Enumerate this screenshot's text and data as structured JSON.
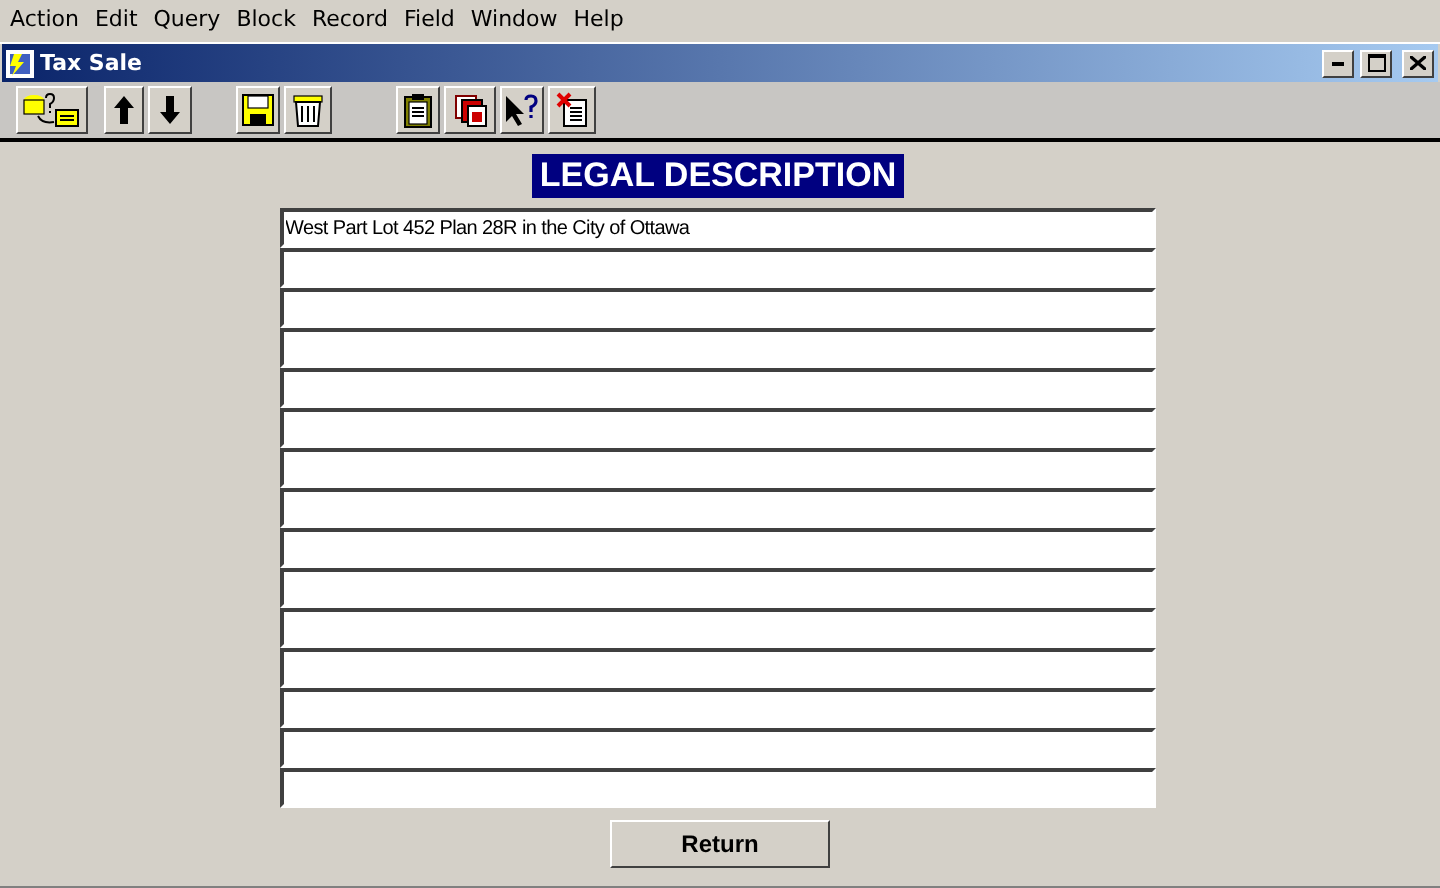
{
  "menu": [
    "Action",
    "Edit",
    "Query",
    "Block",
    "Record",
    "Field",
    "Window",
    "Help"
  ],
  "window": {
    "title": "Tax Sale"
  },
  "toolbar": [
    {
      "kind": "query"
    },
    {
      "kind": "gap"
    },
    {
      "kind": "up"
    },
    {
      "kind": "down"
    },
    {
      "kind": "gap"
    },
    {
      "kind": "save"
    },
    {
      "kind": "delete"
    },
    {
      "kind": "gap"
    },
    {
      "kind": "clipboard"
    },
    {
      "kind": "copy"
    },
    {
      "kind": "help"
    },
    {
      "kind": "exit"
    }
  ],
  "heading": "LEGAL DESCRIPTION",
  "lines": [
    {
      "kind": "text",
      "value": "West Part Lot 452 Plan 28R in the City of Ottawa"
    },
    {
      "kind": "blank"
    },
    {
      "kind": "blank"
    },
    {
      "kind": "blank"
    },
    {
      "kind": "blank"
    },
    {
      "kind": "blank"
    },
    {
      "kind": "blank"
    },
    {
      "kind": "blank"
    },
    {
      "kind": "blank"
    },
    {
      "kind": "blank"
    },
    {
      "kind": "blank"
    },
    {
      "kind": "blank"
    },
    {
      "kind": "blank"
    },
    {
      "kind": "blank"
    },
    {
      "kind": "blank"
    }
  ],
  "button": "Return"
}
